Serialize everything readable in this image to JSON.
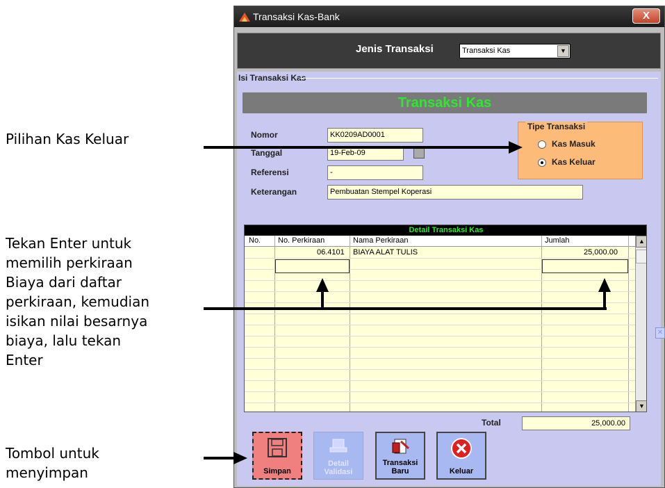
{
  "annotations": {
    "kas_keluar": "Pilihan Kas Keluar",
    "enter_lines": [
      "Tekan Enter untuk",
      "memilih perkiraan",
      "Biaya dari daftar",
      "perkiraan, kemudian",
      "isikan nilai besarnya",
      "biaya, lalu  tekan",
      "Enter"
    ],
    "tombol_lines": [
      "Tombol untuk",
      "menyimpan"
    ]
  },
  "window": {
    "title": "Transaksi Kas-Bank",
    "close": "X"
  },
  "jenis": {
    "label": "Jenis Transaksi",
    "selected": "Transaksi Kas"
  },
  "form": {
    "group_title": "Isi Transaksi Kas",
    "banner": "Transaksi Kas",
    "nomor_label": "Nomor",
    "nomor_value": "KK0209AD0001",
    "tanggal_label": "Tanggal",
    "tanggal_value": "19-Feb-09",
    "referensi_label": "Referensi",
    "referensi_value": "-",
    "keterangan_label": "Keterangan",
    "keterangan_value": "Pembuatan Stempel Koperasi"
  },
  "tipe": {
    "legend": "Tipe Transaksi",
    "masuk": "Kas Masuk",
    "keluar": "Kas Keluar",
    "selected": "keluar"
  },
  "detail": {
    "title": "Detail Transaksi Kas",
    "columns": [
      "No.",
      "No. Perkiraan",
      "Nama Perkiraan",
      "Jumlah"
    ],
    "rows": [
      {
        "no": "",
        "perkiraan": "06.4101",
        "nama": "BIAYA ALAT TULIS",
        "jumlah": "25,000.00"
      }
    ]
  },
  "total": {
    "label": "Total",
    "value": "25,000.00"
  },
  "buttons": {
    "simpan": "Simpan",
    "detail_1": "Detail",
    "detail_2": "Validasi",
    "baru_1": "Transaksi",
    "baru_2": "Baru",
    "keluar": "Keluar"
  }
}
